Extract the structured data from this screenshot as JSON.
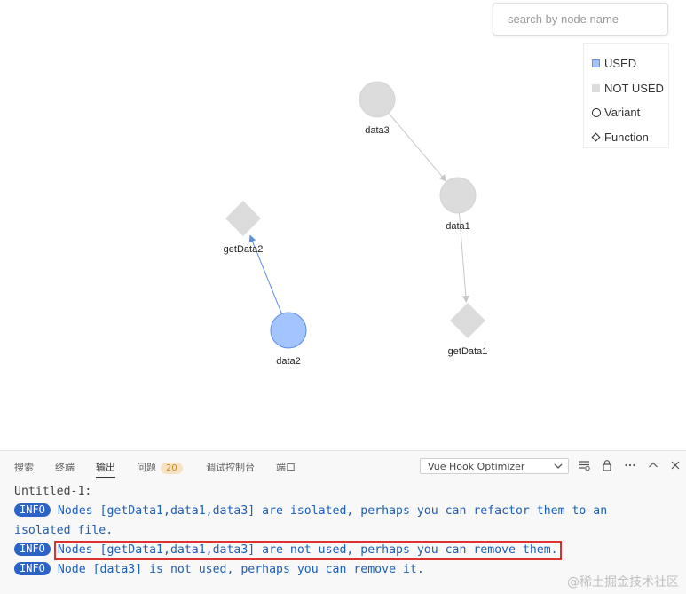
{
  "search": {
    "placeholder": "search by node name",
    "value": ""
  },
  "legend": {
    "items": [
      {
        "label": "USED",
        "symbol": "used-swatch",
        "color": "#a3c4ff"
      },
      {
        "label": "NOT USED",
        "symbol": "not-used-swatch",
        "color": "#dcdcdc"
      },
      {
        "label": "Variant",
        "symbol": "circle-icon"
      },
      {
        "label": "Function",
        "symbol": "diamond-icon"
      }
    ]
  },
  "graph": {
    "nodes": [
      {
        "id": "data3",
        "label": "data3",
        "kind": "variant",
        "used": false
      },
      {
        "id": "data1",
        "label": "data1",
        "kind": "variant",
        "used": false
      },
      {
        "id": "getData1",
        "label": "getData1",
        "kind": "function",
        "used": false
      },
      {
        "id": "getData2",
        "label": "getData2",
        "kind": "function",
        "used": false
      },
      {
        "id": "data2",
        "label": "data2",
        "kind": "variant",
        "used": true
      }
    ],
    "edges": [
      {
        "from": "data3",
        "to": "data1"
      },
      {
        "from": "data1",
        "to": "getData1"
      },
      {
        "from": "data2",
        "to": "getData2"
      }
    ],
    "colors": {
      "used": "#a3c4ff",
      "not_used": "#dcdcdc",
      "used_edge": "#5b8ee6",
      "edge": "#c8c8c8"
    }
  },
  "panel": {
    "tabs": [
      {
        "label": "搜索",
        "active": false
      },
      {
        "label": "终端",
        "active": false
      },
      {
        "label": "输出",
        "active": true
      },
      {
        "label": "问题",
        "active": false,
        "badge": "20"
      },
      {
        "label": "调试控制台",
        "active": false
      },
      {
        "label": "端口",
        "active": false
      }
    ],
    "output_channel": "Vue Hook Optimizer",
    "toolbar_icons": [
      "list-filter-icon",
      "lock-icon",
      "more-icon",
      "chevron-up-icon",
      "close-icon"
    ],
    "output": {
      "header": "Untitled-1:",
      "lines": [
        {
          "tag": "INFO",
          "text": "Nodes [getData1,data1,data3] are isolated, perhaps you can refactor them to an",
          "continuation": "isolated file."
        },
        {
          "tag": "INFO",
          "text": "Nodes [getData1,data1,data3] are not used, perhaps you can remove them.",
          "highlighted": true
        },
        {
          "tag": "INFO",
          "text": "Node [data3] is not used, perhaps you can remove it."
        }
      ]
    }
  },
  "watermark": "@稀土掘金技术社区"
}
